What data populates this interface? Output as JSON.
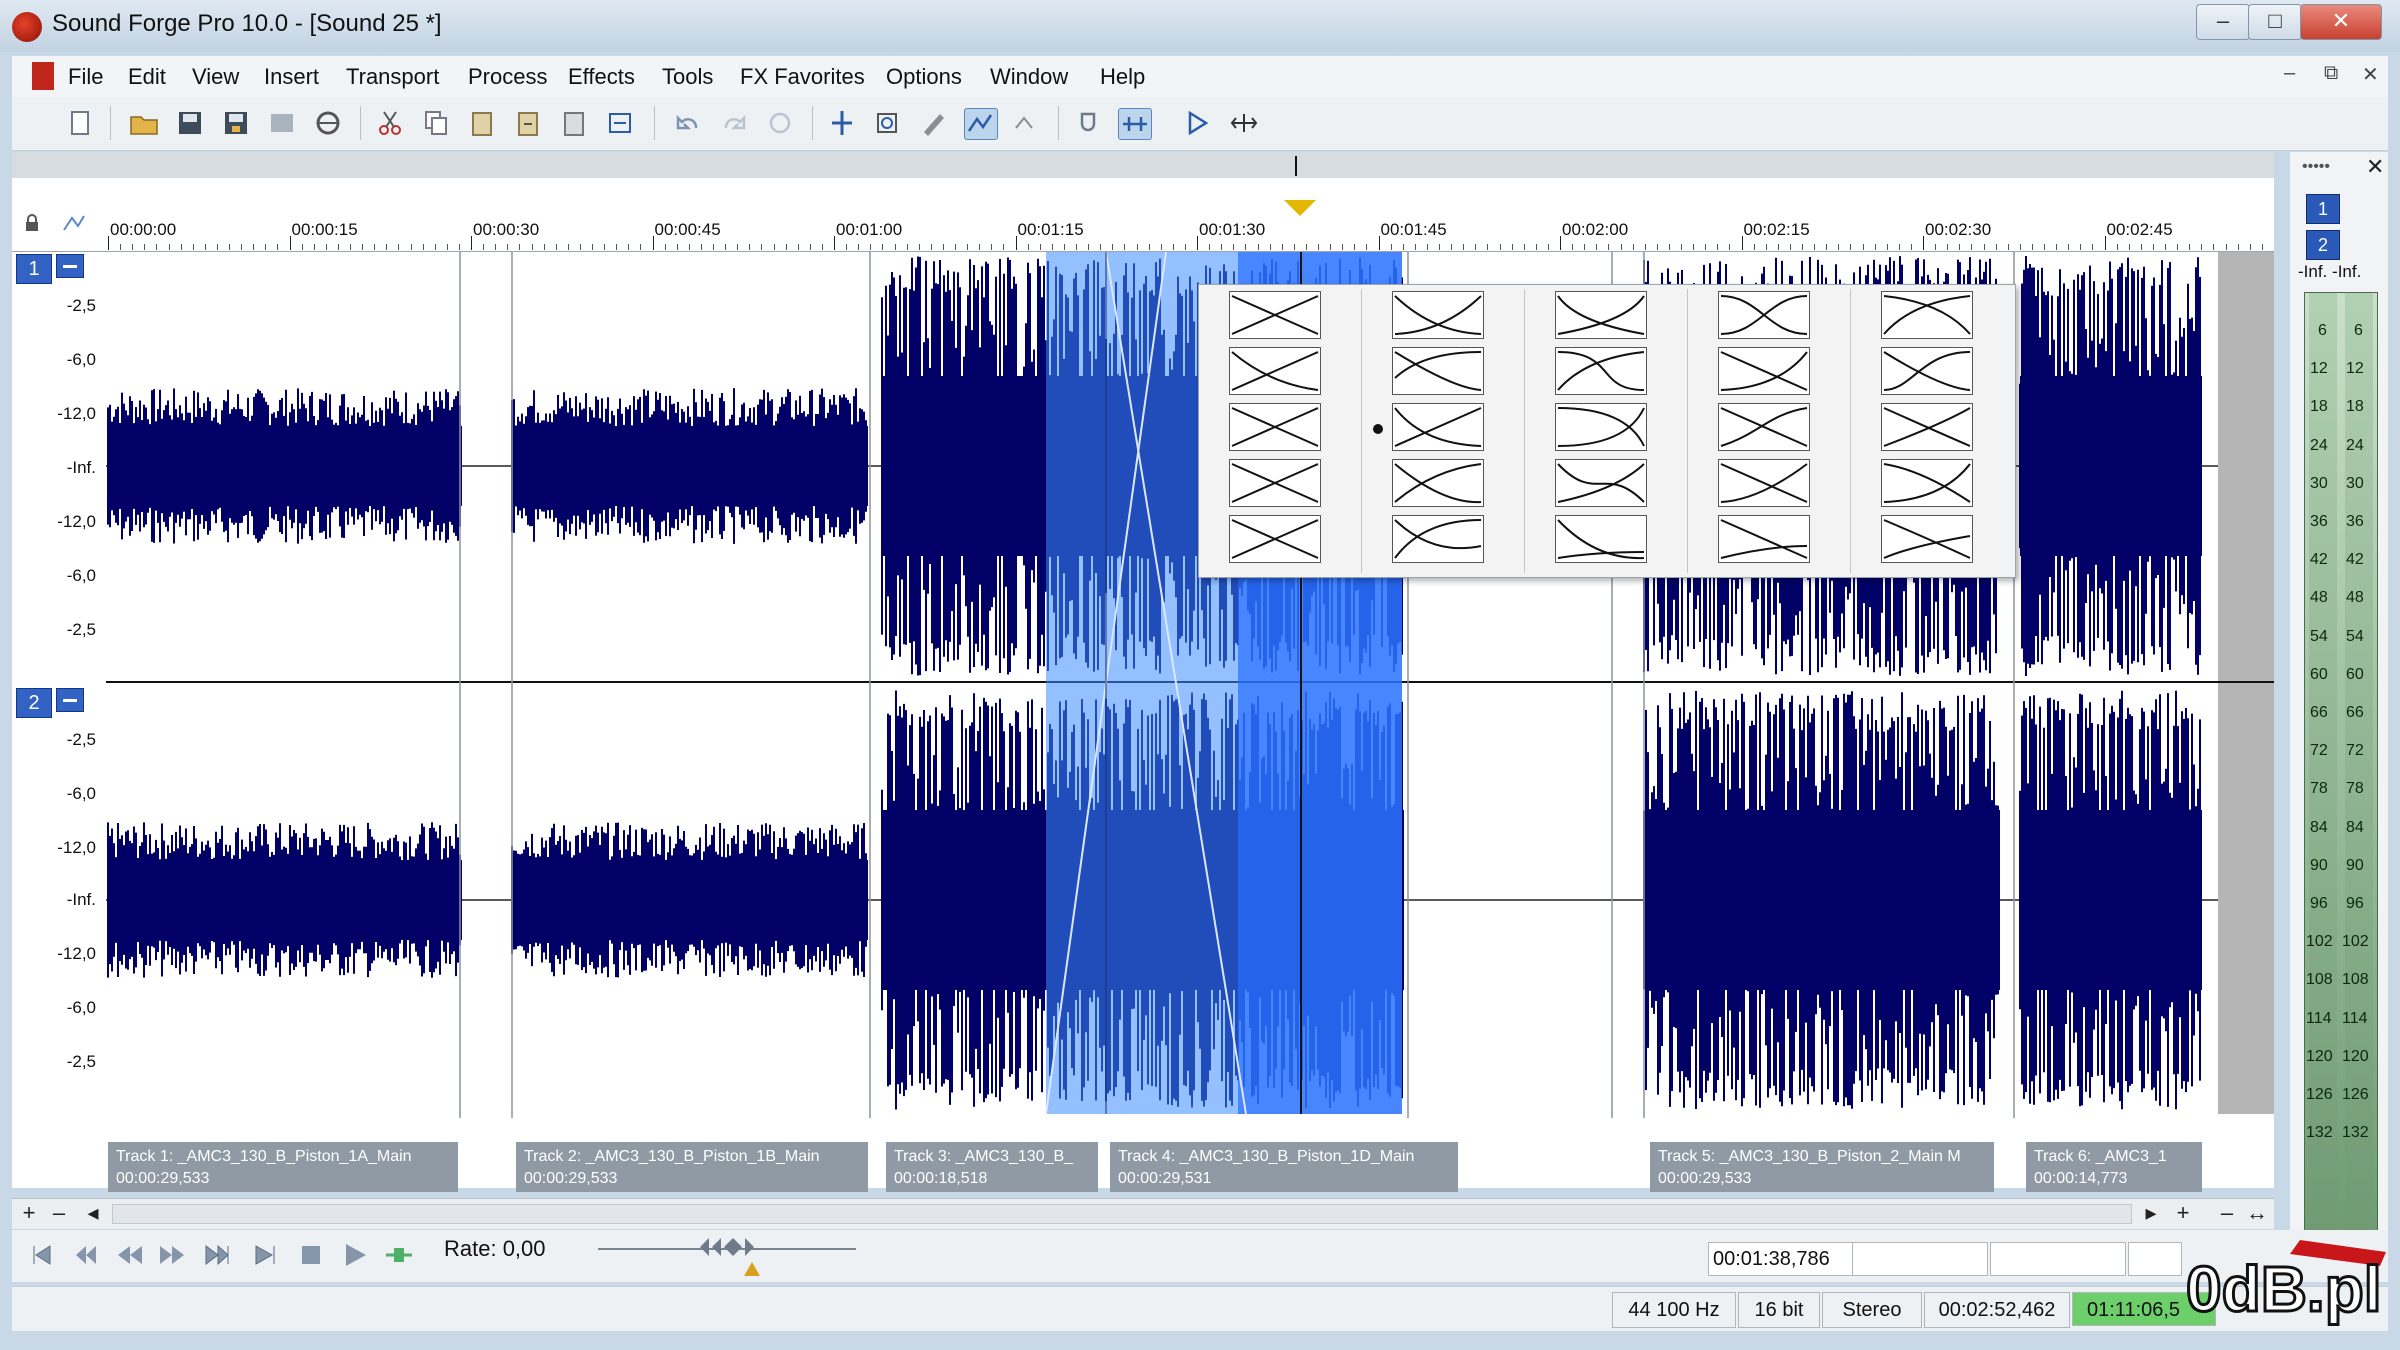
{
  "window": {
    "title": "Sound Forge Pro 10.0 - [Sound 25 *]"
  },
  "menu": [
    "File",
    "Edit",
    "View",
    "Insert",
    "Transport",
    "Process",
    "Effects",
    "Tools",
    "FX Favorites",
    "Options",
    "Window",
    "Help"
  ],
  "ruler": {
    "ticks": [
      "00:00:00",
      "00:00:15",
      "00:00:30",
      "00:00:45",
      "00:01:00",
      "00:01:15",
      "00:01:30",
      "00:01:45",
      "00:02:00",
      "00:02:15",
      "00:02:30",
      "00:02:45"
    ]
  },
  "channels": [
    {
      "id": "1",
      "db_labels": [
        "-2,5",
        "-6,0",
        "-12,0",
        "-Inf.",
        "-12,0",
        "-6,0",
        "-2,5"
      ]
    },
    {
      "id": "2",
      "db_labels": [
        "-2,5",
        "-6,0",
        "-12,0",
        "-Inf.",
        "-12,0",
        "-6,0",
        "-2,5"
      ]
    }
  ],
  "clips": [
    {
      "name": "Track 1: _AMC3_130_B_Piston_1A_Main",
      "length": "00:00:29,533"
    },
    {
      "name": "Track 2: _AMC3_130_B_Piston_1B_Main",
      "length": "00:00:29,533"
    },
    {
      "name": "Track 3: _AMC3_130_B_",
      "length": "00:00:18,518"
    },
    {
      "name": "Track 4: _AMC3_130_B_Piston_1D_Main",
      "length": "00:00:29,531"
    },
    {
      "name": "Track 5: _AMC3_130_B_Piston_2_Main M",
      "length": "00:00:29,533"
    },
    {
      "name": "Track 6: _AMC3_1",
      "length": "00:00:14,773"
    }
  ],
  "meters": {
    "channels": [
      "1",
      "2"
    ],
    "peak": [
      "-Inf.",
      "-Inf."
    ],
    "scale": [
      "6",
      "12",
      "18",
      "24",
      "30",
      "36",
      "42",
      "48",
      "54",
      "60",
      "66",
      "72",
      "78",
      "84",
      "90",
      "96",
      "102",
      "108",
      "114",
      "120",
      "126",
      "132"
    ]
  },
  "transport": {
    "rate_label": "Rate: 0,00",
    "position": "00:01:38,786"
  },
  "status": {
    "sample_rate": "44 100 Hz",
    "bit_depth": "16 bit",
    "channels": "Stereo",
    "length": "00:02:52,462",
    "record_time": "01:11:06,5"
  },
  "watermark": "0dB.pl",
  "colors": {
    "waveform": "#000066",
    "selection": "#3c8cff",
    "channel_badge": "#3162c4",
    "record_time_bg": "#6dcf6a"
  }
}
